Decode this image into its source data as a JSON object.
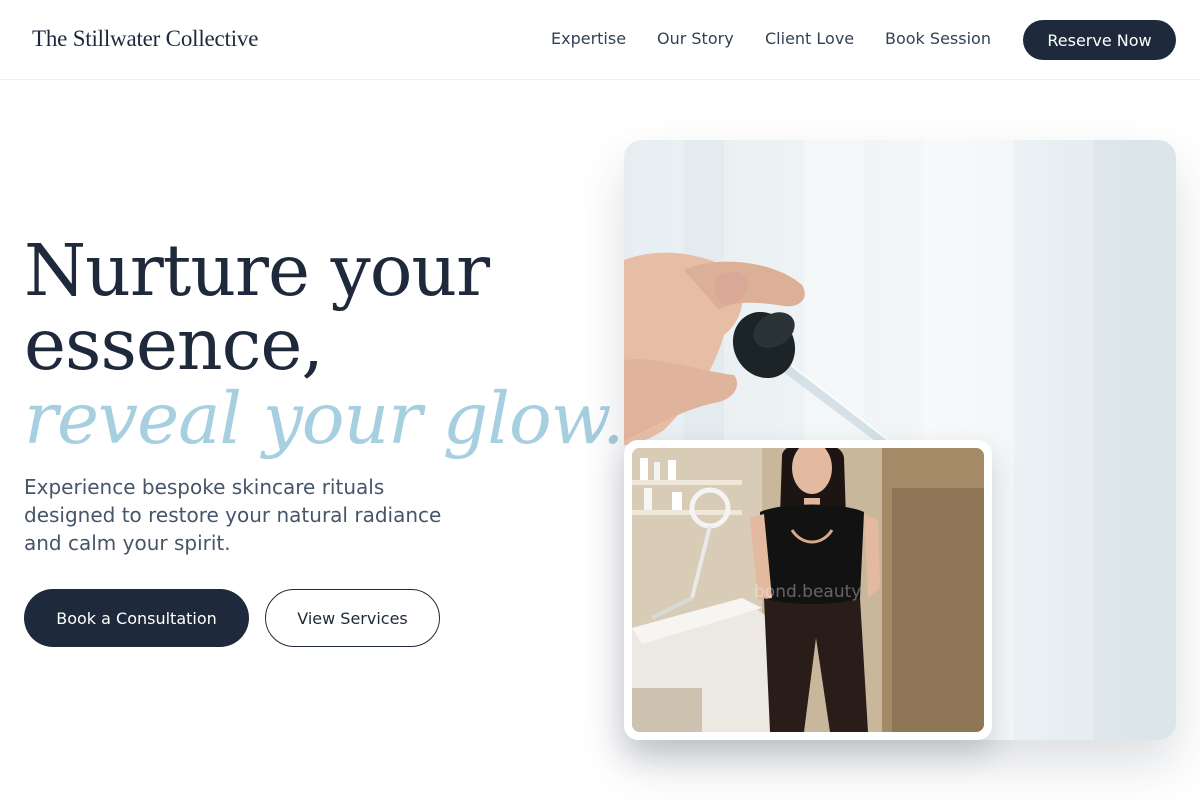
{
  "header": {
    "brand": "The Stillwater Collective",
    "nav": [
      "Expertise",
      "Our Story",
      "Client Love",
      "Book Session"
    ],
    "cta": "Reserve Now"
  },
  "hero": {
    "headline_line1": "Nurture your",
    "headline_line2": "essence,",
    "headline_accent": "reveal your glow.",
    "subtext": "Experience bespoke skincare rituals designed to restore your natural radiance and calm your spirit.",
    "primary_button": "Book a Consultation",
    "secondary_button": "View Services"
  },
  "images": {
    "main": "serum-dropper-photo",
    "inset": "esthetician-portrait-photo",
    "inset_watermark": "bond.beauty"
  },
  "colors": {
    "navy": "#1e293b",
    "accent_blue": "#a6cfe0",
    "body_text": "#475569"
  }
}
